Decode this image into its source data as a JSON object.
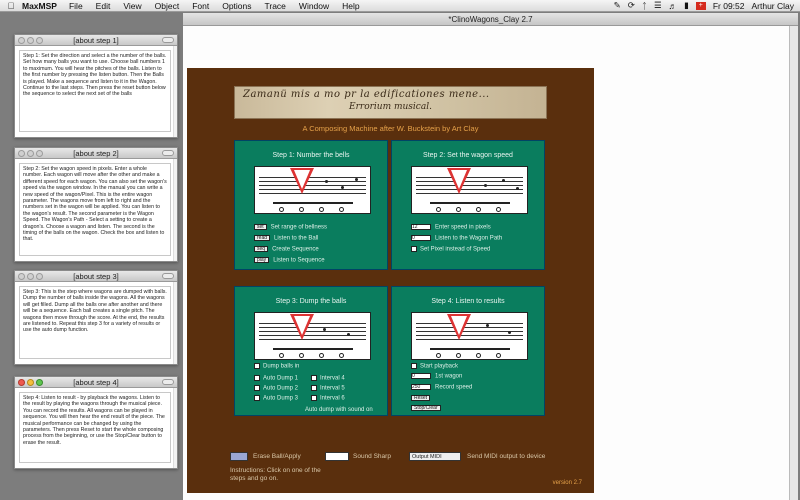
{
  "menubar": {
    "app": "MaxMSP",
    "items": [
      "File",
      "Edit",
      "View",
      "Object",
      "Font",
      "Options",
      "Trace",
      "Window",
      "Help"
    ],
    "clock": "Fr 09:52",
    "user": "Arthur Clay"
  },
  "patcher": {
    "title": "*ClinoWagons_Clay 2.7",
    "manuscript": {
      "line1": "Zamanü mis a mo pr la edificationes mene...",
      "line2": "Errorium musical."
    },
    "subtitle": "A Composing Machine after W. Buckstein by Art Clay",
    "steps": [
      {
        "title": "Step 1: Number the bells",
        "controls": [
          {
            "kind": "btn",
            "label": "Set range of bellness",
            "value": "set"
          },
          {
            "kind": "btn",
            "label": "Listen to the Ball",
            "value": "read"
          },
          {
            "kind": "btn",
            "label": "Create Sequence",
            "value": "seq"
          },
          {
            "kind": "btn",
            "label": "Listen to Sequence",
            "value": "play"
          }
        ]
      },
      {
        "title": "Step 2: Set the wagon speed",
        "controls": [
          {
            "kind": "num",
            "label": "Enter speed in pixels",
            "value": "12"
          },
          {
            "kind": "num",
            "label": "Listen to the Wagon Path",
            "value": "0"
          },
          {
            "kind": "chk",
            "label": "Set Pixel instead of Speed"
          }
        ]
      },
      {
        "title": "Step 3: Dump the balls",
        "controls": [
          {
            "kind": "chk",
            "label": "Dump balls in"
          },
          {
            "kind": "chk",
            "label": "Auto Dump 1"
          },
          {
            "kind": "chk",
            "label": "Auto Dump 2"
          },
          {
            "kind": "chk",
            "label": "Auto Dump 3"
          },
          {
            "kind": "chk",
            "label": "Interval 4"
          },
          {
            "kind": "chk",
            "label": "Interval 5"
          },
          {
            "kind": "chk",
            "label": "Interval 6"
          }
        ],
        "footer": "Auto dump with sound on"
      },
      {
        "title": "Step 4: Listen to results",
        "controls": [
          {
            "kind": "chk",
            "label": "Start playback"
          },
          {
            "kind": "num",
            "label": "1st wagon",
            "value": "0"
          },
          {
            "kind": "num",
            "label": "Record speed",
            "value": "250"
          },
          {
            "kind": "btn",
            "label": "Reset",
            "value": "Reset"
          },
          {
            "kind": "btn",
            "label": "Stop/Clear",
            "value": "Stop/Clear"
          }
        ]
      }
    ],
    "bottom": {
      "bpm_label": "Erase Ball/Apply",
      "sound_label": "Sound Sharp",
      "output_menu": "Output MIDI",
      "output_label": "Send MIDI output to device",
      "instructions": "Instructions: Click on one of the\nsteps and go on.",
      "version": "version 2.7"
    }
  },
  "windows": [
    {
      "title": "[about step 1]",
      "active": false,
      "text": "Step 1: Set the direction and select a the number of the balls. Set how many balls you want to use. Choose ball numbers 1 to maximum. You will hear the pitches of the balls. Listen to the first number by pressing the listen button. Then the Balls is played. Make a sequence and listen to it in the Wagon. Continue to the last steps. Then press the reset button below the sequence to select the next set of the balls"
    },
    {
      "title": "[about step 2]",
      "active": false,
      "text": "Step 2: Set the wagon speed in pixels. Enter a whole number. Each wagon will move after the other and make a different speed for each wagon. You can also set the wagon's speed via the wagon window. In the manual you can write a new speed of the wagon/Pixel. This is the entire wagon parameter. The wagons move from left to right and the numbers set in the wagon will be applied. You can listen to the wagon's result. The second parameter is the Wagon Speed. The Wagon's Path - Select a setting to create a dragon's. Choose a wagon and listen. The second is the timing of the balls on the wagon. Check the box and listen to that."
    },
    {
      "title": "[about step 3]",
      "active": false,
      "text": "Step 3: This is the step where wagons are dumped with balls. Dump the number of balls inside the wagons. All the wagons will get filled. Dump all the balls one after another and there will be a sequence. Each ball creates a single pitch. The wagons then move through the score. At the end, the results are listened to. Repeat this step 3 for a variety of results or use the auto dump function."
    },
    {
      "title": "[about step 4]",
      "active": true,
      "text": "Step 4: Listen to result - by playback the wagons. Listen to the result by playing the wagons through the musical piece. You can record the results. All wagons can be played in sequence. You will then hear the end result of the piece. The musical performance can be changed by using the parameters. Then press Reset to start the whole composing process from the beginning, or use the Stop/Clear button to erase the result."
    }
  ]
}
